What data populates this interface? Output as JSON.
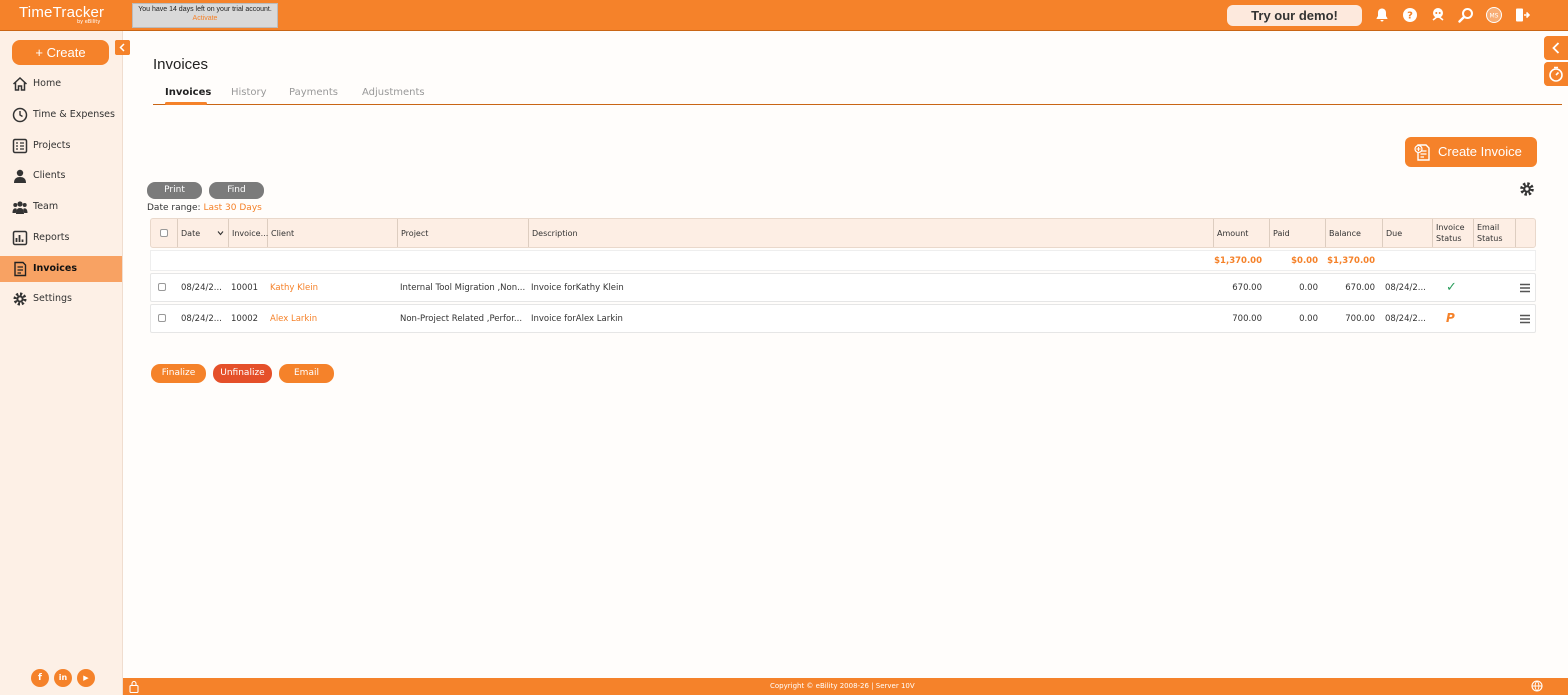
{
  "app": {
    "logo": "TimeTracker",
    "logo_sub": "by eBility",
    "trial_text": "You have 14 days left on your trial account.",
    "trial_link": "Activate",
    "demo_button": "Try our demo!",
    "user_initials": "MS"
  },
  "sidebar": {
    "create_label": "+ Create",
    "items": [
      {
        "label": "Home",
        "icon": "home-icon"
      },
      {
        "label": "Time & Expenses",
        "icon": "clock-icon"
      },
      {
        "label": "Projects",
        "icon": "projects-icon"
      },
      {
        "label": "Clients",
        "icon": "clients-icon"
      },
      {
        "label": "Team",
        "icon": "team-icon"
      },
      {
        "label": "Reports",
        "icon": "reports-icon"
      },
      {
        "label": "Invoices",
        "icon": "invoices-icon",
        "active": true
      },
      {
        "label": "Settings",
        "icon": "gear-icon"
      }
    ],
    "social": [
      "f",
      "in",
      "▶"
    ]
  },
  "page": {
    "title": "Invoices",
    "tabs": [
      "Invoices",
      "History",
      "Payments",
      "Adjustments"
    ],
    "create_invoice": "Create Invoice",
    "print": "Print",
    "find": "Find",
    "date_range_label": "Date range:",
    "date_range_value": "Last 30 Days"
  },
  "table": {
    "headers": {
      "date": "Date",
      "invoice": "Invoice...",
      "client": "Client",
      "project": "Project",
      "description": "Description",
      "amount": "Amount",
      "paid": "Paid",
      "balance": "Balance",
      "due": "Due",
      "invoice_status": "Invoice Status",
      "email_status": "Email Status"
    },
    "totals": {
      "amount": "$1,370.00",
      "paid": "$0.00",
      "balance": "$1,370.00"
    },
    "rows": [
      {
        "date": "08/24/2...",
        "invoice": "10001",
        "client": "Kathy Klein",
        "project": "Internal Tool Migration ,Non...",
        "description": "Invoice forKathy Klein",
        "amount": "670.00",
        "paid": "0.00",
        "balance": "670.00",
        "due": "08/24/2...",
        "status": "✓"
      },
      {
        "date": "08/24/2...",
        "invoice": "10002",
        "client": "Alex Larkin",
        "project": "Non-Project Related ,Perfor...",
        "description": "Invoice forAlex Larkin",
        "amount": "700.00",
        "paid": "0.00",
        "balance": "700.00",
        "due": "08/24/2...",
        "status": "P"
      }
    ]
  },
  "actions": {
    "finalize": "Finalize",
    "unfinalize": "Unfinalize",
    "email": "Email"
  },
  "footer": {
    "copyright": "Copyright © eBility 2008-26 | Server 10V"
  },
  "colors": {
    "accent": "#f5822a",
    "unfinalize": "#e5502a",
    "status_check": "#2a9d5c"
  }
}
